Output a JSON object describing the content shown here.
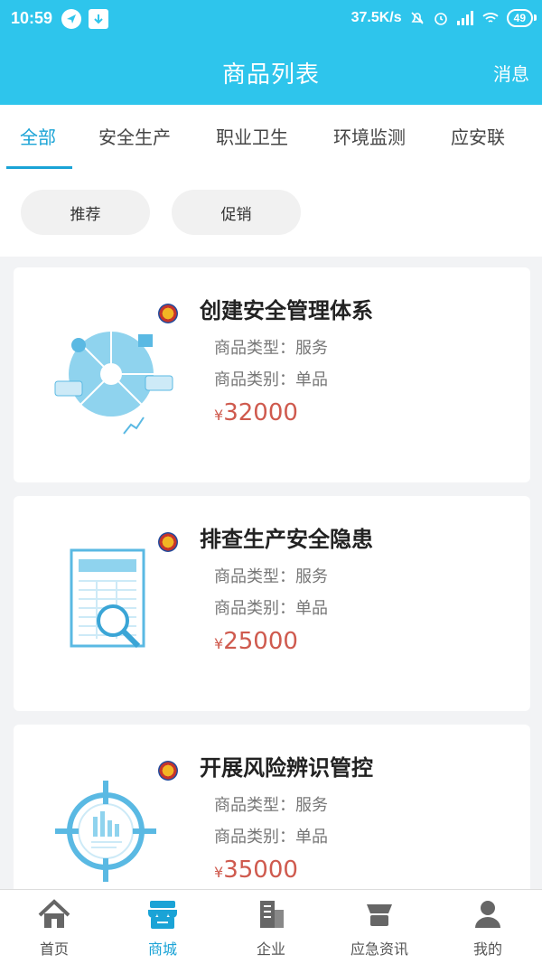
{
  "status": {
    "time": "10:59",
    "speed": "37.5K/s",
    "battery": "49"
  },
  "header": {
    "title": "商品列表",
    "message_label": "消息"
  },
  "category_tabs": [
    {
      "label": "全部",
      "active": true
    },
    {
      "label": "安全生产",
      "active": false
    },
    {
      "label": "职业卫生",
      "active": false
    },
    {
      "label": "环境监测",
      "active": false
    },
    {
      "label": "应安联",
      "active": false
    }
  ],
  "filters": [
    {
      "label": "推荐"
    },
    {
      "label": "促销"
    }
  ],
  "products": [
    {
      "title": "创建安全管理体系",
      "type": "商品类型：服务",
      "category": "商品类别：单品",
      "currency": "¥",
      "price": "32000",
      "icon": "pie-chart-illustration"
    },
    {
      "title": "排查生产安全隐患",
      "type": "商品类型：服务",
      "category": "商品类别：单品",
      "currency": "¥",
      "price": "25000",
      "icon": "document-search-illustration"
    },
    {
      "title": "开展风险辨识管控",
      "type": "商品类型：服务",
      "category": "商品类别：单品",
      "currency": "¥",
      "price": "35000",
      "icon": "crosshair-chart-illustration"
    }
  ],
  "bottom_nav": [
    {
      "label": "首页",
      "icon": "home-icon",
      "active": false
    },
    {
      "label": "商城",
      "icon": "store-icon",
      "active": true
    },
    {
      "label": "企业",
      "icon": "building-icon",
      "active": false
    },
    {
      "label": "应急资讯",
      "icon": "news-icon",
      "active": false
    },
    {
      "label": "我的",
      "icon": "user-icon",
      "active": false
    }
  ],
  "colors": {
    "primary": "#2ec5ec",
    "accent": "#1aa3d6",
    "price": "#cf5a4e"
  }
}
